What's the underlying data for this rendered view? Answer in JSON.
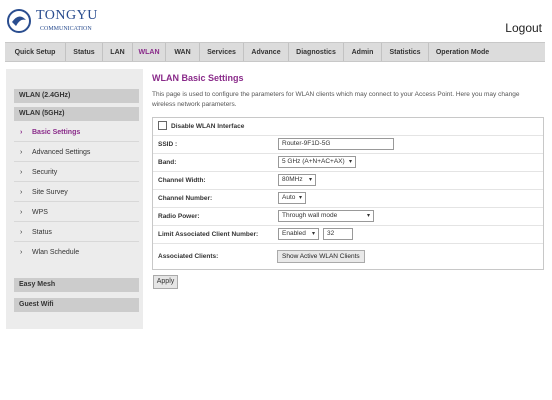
{
  "header": {
    "brand_name": "TONGYU",
    "brand_sub": "COMMUNICATION",
    "logout_label": "Logout"
  },
  "nav": {
    "items": [
      "Quick Setup",
      "Status",
      "LAN",
      "WLAN",
      "WAN",
      "Services",
      "Advance",
      "Diagnostics",
      "Admin",
      "Statistics",
      "Operation Mode"
    ],
    "active": "WLAN"
  },
  "sidebar": {
    "group_24": "WLAN (2.4GHz)",
    "group_5": "WLAN (5GHz)",
    "items": [
      "Basic Settings",
      "Advanced Settings",
      "Security",
      "Site Survey",
      "WPS",
      "Status",
      "Wlan Schedule"
    ],
    "easy_mesh": "Easy Mesh",
    "guest_wifi": "Guest Wifi"
  },
  "main": {
    "title": "WLAN Basic Settings",
    "description": "This page is used to configure the parameters for WLAN clients which may connect to your Access Point. Here you may change wireless network parameters.",
    "disable_label": "Disable WLAN Interface",
    "ssid_label": "SSID :",
    "ssid_value": "Router-9F1D-5G",
    "band_label": "Band:",
    "band_value": "5 GHz (A+N+AC+AX)",
    "channel_width_label": "Channel Width:",
    "channel_width_value": "80MHz",
    "channel_number_label": "Channel Number:",
    "channel_number_value": "Auto",
    "radio_power_label": "Radio Power:",
    "radio_power_value": "Through wall mode",
    "limit_label": "Limit Associated Client Number:",
    "limit_value": "Enabled",
    "limit_count": "32",
    "assoc_label": "Associated Clients:",
    "assoc_button": "Show Active WLAN Clients",
    "apply_button": "Apply"
  },
  "colors": {
    "accent": "#8a2b8a",
    "brand": "#2a4d8f"
  }
}
